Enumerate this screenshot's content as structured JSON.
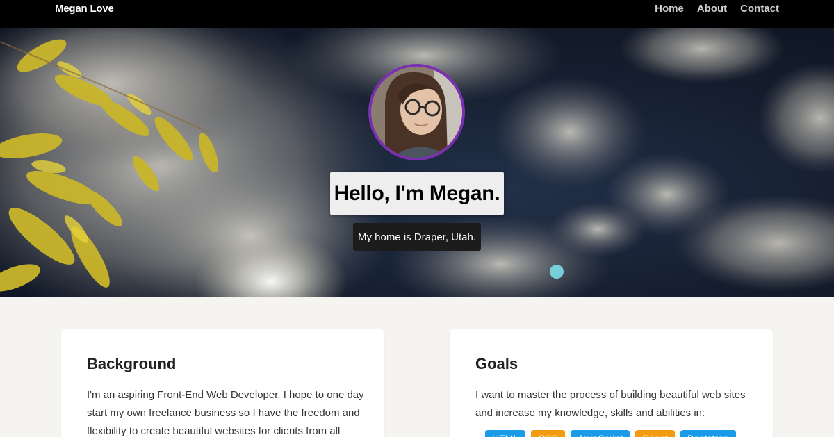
{
  "nav": {
    "brand": "Megan Love",
    "links": [
      "Home",
      "About",
      "Contact"
    ]
  },
  "hero": {
    "title": "Hello, I'm Megan.",
    "subtitle": "My home is Draper, Utah.",
    "accent": "#7b2fb3"
  },
  "background_card": {
    "title": "Background",
    "text": "I'm an aspiring Front-End Web Developer. I hope to one day start my own freelance business so I have the freedom and flexibility to create beautiful websites for clients from all"
  },
  "goals_card": {
    "title": "Goals",
    "text": "I want to master the process of building beautiful web sites and increase my knowledge, skills and abilities in:",
    "tags": [
      {
        "label": "HTML",
        "color": "#1a9be8"
      },
      {
        "label": "CSS",
        "color": "#f39c12"
      },
      {
        "label": "JavaScript",
        "color": "#1a9be8"
      },
      {
        "label": "React",
        "color": "#f39c12"
      },
      {
        "label": "Bootstrap",
        "color": "#1a9be8"
      }
    ]
  }
}
